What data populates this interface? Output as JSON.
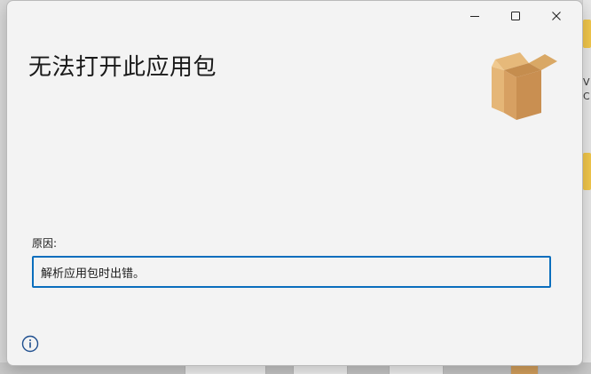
{
  "window": {
    "title": "无法打开此应用包",
    "controls": {
      "minimize_icon": "minimize-icon",
      "maximize_icon": "maximize-icon",
      "close_icon": "close-icon"
    }
  },
  "reason": {
    "label": "原因:",
    "value": "解析应用包时出错。"
  },
  "background": {
    "letters": [
      "V",
      "C"
    ]
  },
  "colors": {
    "accent": "#0a6ebd",
    "window_bg": "#f3f3f3"
  }
}
